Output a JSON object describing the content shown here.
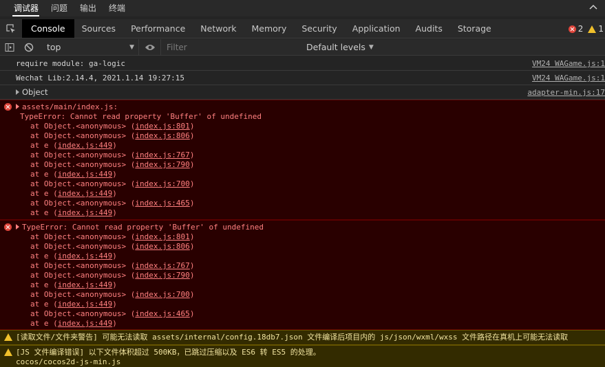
{
  "panel_tabs": [
    "调试器",
    "问题",
    "输出",
    "终端"
  ],
  "tool_tabs": [
    "Console",
    "Sources",
    "Performance",
    "Network",
    "Memory",
    "Security",
    "Application",
    "Audits",
    "Storage"
  ],
  "issues": {
    "errors": "2",
    "warnings": "1"
  },
  "filter_bar": {
    "context": "top",
    "filter_placeholder": "Filter",
    "levels": "Default levels"
  },
  "colors": {
    "error_bg": "#290000",
    "error_text": "#ff8080",
    "warn_bg": "#332b00",
    "accent_error": "#e0453b",
    "accent_warn": "#f0c02b"
  },
  "logs": [
    {
      "text": "require module: ga-logic",
      "source": "VM24 WAGame.js:1"
    },
    {
      "text": "Wechat Lib:2.14.4, 2021.1.14 19:27:15",
      "source": "VM24 WAGame.js:1"
    },
    {
      "text": "Object",
      "source": "adapter-min.js:17"
    }
  ],
  "error1": {
    "header": "assets/main/index.js:",
    "message": "TypeError: Cannot read property 'Buffer' of undefined",
    "stack": [
      {
        "pre": "at Object.<anonymous> (",
        "link": "index.js:801",
        "post": ")"
      },
      {
        "pre": "at Object.<anonymous> (",
        "link": "index.js:806",
        "post": ")"
      },
      {
        "pre": "at e (",
        "link": "index.js:449",
        "post": ")"
      },
      {
        "pre": "at Object.<anonymous> (",
        "link": "index.js:767",
        "post": ")"
      },
      {
        "pre": "at Object.<anonymous> (",
        "link": "index.js:790",
        "post": ")"
      },
      {
        "pre": "at e (",
        "link": "index.js:449",
        "post": ")"
      },
      {
        "pre": "at Object.<anonymous> (",
        "link": "index.js:700",
        "post": ")"
      },
      {
        "pre": "at e (",
        "link": "index.js:449",
        "post": ")"
      },
      {
        "pre": "at Object.<anonymous> (",
        "link": "index.js:465",
        "post": ")"
      },
      {
        "pre": "at e (",
        "link": "index.js:449",
        "post": ")"
      }
    ]
  },
  "error2": {
    "message": "TypeError: Cannot read property 'Buffer' of undefined",
    "stack": [
      {
        "pre": "at Object.<anonymous> (",
        "link": "index.js:801",
        "post": ")"
      },
      {
        "pre": "at Object.<anonymous> (",
        "link": "index.js:806",
        "post": ")"
      },
      {
        "pre": "at e (",
        "link": "index.js:449",
        "post": ")"
      },
      {
        "pre": "at Object.<anonymous> (",
        "link": "index.js:767",
        "post": ")"
      },
      {
        "pre": "at Object.<anonymous> (",
        "link": "index.js:790",
        "post": ")"
      },
      {
        "pre": "at e (",
        "link": "index.js:449",
        "post": ")"
      },
      {
        "pre": "at Object.<anonymous> (",
        "link": "index.js:700",
        "post": ")"
      },
      {
        "pre": "at e (",
        "link": "index.js:449",
        "post": ")"
      },
      {
        "pre": "at Object.<anonymous> (",
        "link": "index.js:465",
        "post": ")"
      },
      {
        "pre": "at e (",
        "link": "index.js:449",
        "post": ")"
      }
    ]
  },
  "warnings": [
    {
      "lines": [
        "[读取文件/文件夹警告] 可能无法读取 assets/internal/config.18db7.json 文件编译后项目内的 js/json/wxml/wxss 文件路径在真机上可能无法读取"
      ]
    },
    {
      "lines": [
        "[JS 文件编译错误] 以下文件体积超过 500KB，已跳过压缩以及 ES6 转 ES5 的处理。",
        "cocos/cocos2d-js-min.js"
      ]
    }
  ]
}
